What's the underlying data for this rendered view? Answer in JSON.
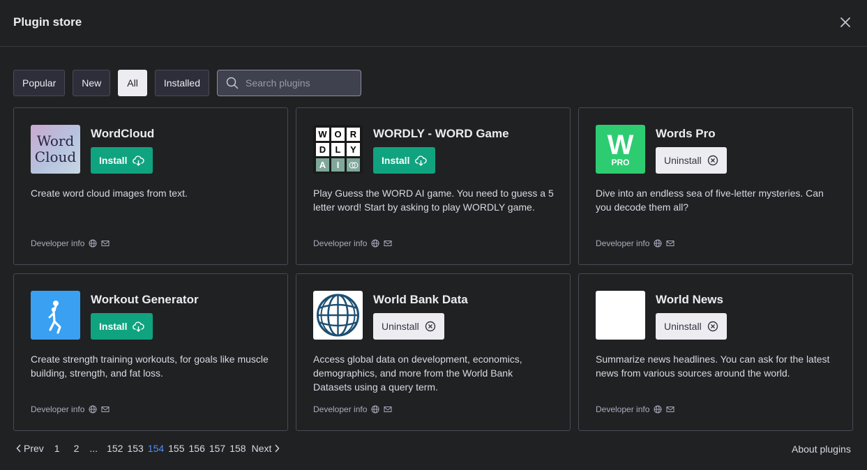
{
  "header": {
    "title": "Plugin store"
  },
  "filters": {
    "popular": "Popular",
    "new": "New",
    "all": "All",
    "installed": "Installed",
    "active": "All"
  },
  "search": {
    "placeholder": "Search plugins",
    "value": ""
  },
  "colors": {
    "install": "#10a37f",
    "accent_page": "#4f8ff7",
    "background": "#202123"
  },
  "plugins": [
    {
      "name": "WordCloud",
      "action": "Install",
      "description": "Create word cloud images from text.",
      "developer": "Developer info",
      "logo_text": [
        "Word",
        "Cloud"
      ]
    },
    {
      "name": "WORDLY - WORD Game",
      "action": "Install",
      "description": "Play Guess the WORD AI game. You need to guess a 5 letter word! Start by asking to play WORDLY game.",
      "developer": "Developer info",
      "logo_text": [
        "W",
        "O",
        "R",
        "D",
        "L",
        "Y",
        "A",
        "I"
      ]
    },
    {
      "name": "Words Pro",
      "action": "Uninstall",
      "description": "Dive into an endless sea of five-letter mysteries. Can you decode them all?",
      "developer": "Developer info",
      "logo_text": [
        "W",
        "PRO"
      ]
    },
    {
      "name": "Workout Generator",
      "action": "Install",
      "description": "Create strength training workouts, for goals like muscle building, strength, and fat loss.",
      "developer": "Developer info",
      "logo_icon": "athlete-icon"
    },
    {
      "name": "World Bank Data",
      "action": "Uninstall",
      "description": "Access global data on development, economics, demographics, and more from the World Bank Datasets using a query term.",
      "developer": "Developer info",
      "logo_icon": "globe-icon"
    },
    {
      "name": "World News",
      "action": "Uninstall",
      "description": "Summarize news headlines. You can ask for the latest news from various sources around the world.",
      "developer": "Developer info",
      "logo_icon": "blank-logo"
    }
  ],
  "pagination": {
    "prev": "Prev",
    "next": "Next",
    "pages": [
      "1",
      "2",
      "...",
      "152",
      "153",
      "154",
      "155",
      "156",
      "157",
      "158"
    ],
    "current": "154"
  },
  "footer": {
    "about": "About plugins"
  }
}
